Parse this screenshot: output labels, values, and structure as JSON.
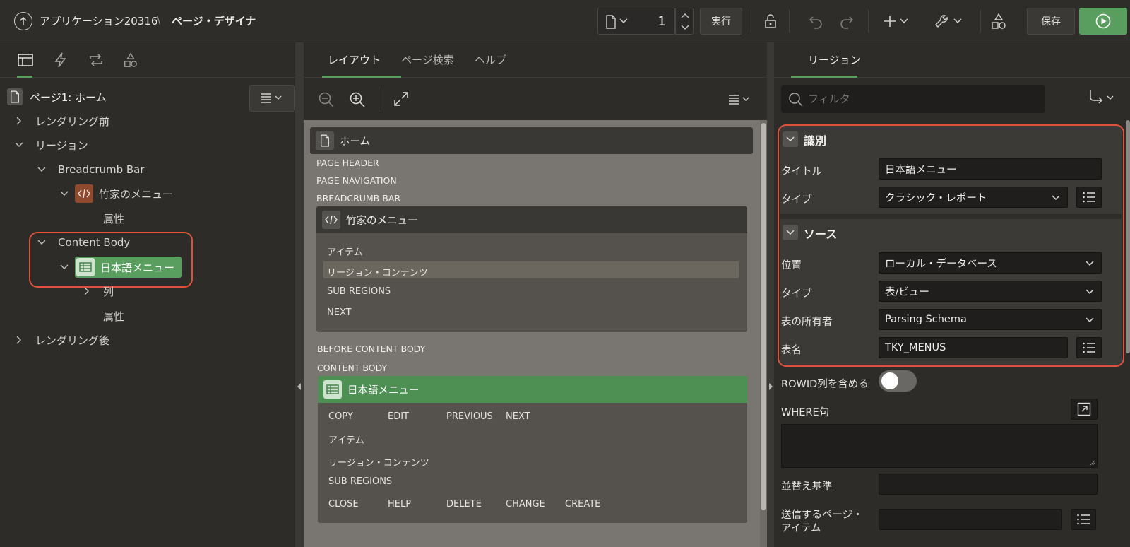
{
  "topbar": {
    "app_title": "アプリケーション20316",
    "separator": "\\",
    "page_designer": "ページ・デザイナ",
    "page_number": "1",
    "run_label": "実行",
    "save_label": "保存"
  },
  "left": {
    "page_title": "ページ1: ホーム",
    "tree": {
      "before_rendering": "レンダリング前",
      "regions": "リージョン",
      "breadcrumb_bar": "Breadcrumb Bar",
      "takeya_menu": "竹家のメニュー",
      "attributes1": "属性",
      "content_body": "Content Body",
      "japanese_menu": "日本語メニュー",
      "columns": "列",
      "attributes2": "属性",
      "after_rendering": "レンダリング後"
    }
  },
  "center": {
    "tabs": [
      "レイアウト",
      "ページ検索",
      "ヘルプ"
    ],
    "page_home": "ホーム",
    "page_header": "PAGE HEADER",
    "page_navigation": "PAGE NAVIGATION",
    "breadcrumb_bar": "BREADCRUMB BAR",
    "takeya_region": {
      "title": "竹家のメニュー",
      "items": "アイテム",
      "region_content": "リージョン・コンテンツ",
      "sub_regions": "SUB REGIONS",
      "next": "NEXT"
    },
    "before_content_body": "BEFORE CONTENT BODY",
    "content_body": "CONTENT BODY",
    "jp_region": {
      "title": "日本語メニュー",
      "copy": "COPY",
      "edit": "EDIT",
      "previous": "PREVIOUS",
      "next": "NEXT",
      "items": "アイテム",
      "region_content": "リージョン・コンテンツ",
      "sub_regions": "SUB REGIONS",
      "close": "CLOSE",
      "help": "HELP",
      "delete": "DELETE",
      "change": "CHANGE",
      "create": "CREATE"
    }
  },
  "right": {
    "tab": "リージョン",
    "filter_placeholder": "フィルタ",
    "identification": {
      "heading": "識別",
      "title_label": "タイトル",
      "title_value": "日本語メニュー",
      "type_label": "タイプ",
      "type_value": "クラシック・レポート"
    },
    "source": {
      "heading": "ソース",
      "location_label": "位置",
      "location_value": "ローカル・データベース",
      "type_label": "タイプ",
      "type_value": "表/ビュー",
      "owner_label": "表の所有者",
      "owner_value": "Parsing Schema",
      "table_label": "表名",
      "table_value": "TKY_MENUS"
    },
    "rowid_label": "ROWID列を含める",
    "rowid_on": false,
    "where_label": "WHERE句",
    "order_label": "並替え基準",
    "submit_label_line1": "送信するページ・",
    "submit_label_line2": "アイテム"
  },
  "colors": {
    "accent_green": "#5a9e5f",
    "highlight_red": "#e0513c"
  }
}
